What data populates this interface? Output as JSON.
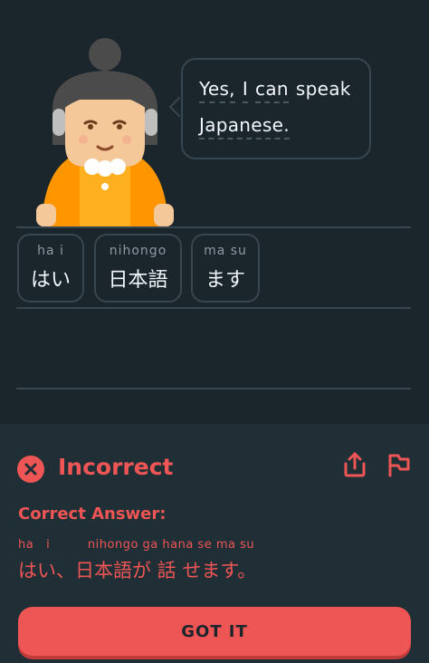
{
  "speech_bubble": {
    "line1": [
      "Yes,",
      "I",
      "can",
      "speak"
    ],
    "line2": [
      "Japanese."
    ]
  },
  "word_bank": [
    {
      "romaji": "ha  i",
      "japanese": "はい"
    },
    {
      "romaji": "nihongo",
      "japanese": "日本語"
    },
    {
      "romaji": "ma su",
      "japanese": "ます"
    }
  ],
  "feedback": {
    "status": "Incorrect",
    "correct_label": "Correct Answer:",
    "answer_romaji": "ha   i         nihongo ga hana se ma su",
    "answer_japanese": "はい、日本語が 話 せます。",
    "button_label": "GOT IT"
  },
  "colors": {
    "background": "#1b252c",
    "panel": "#202f36",
    "error": "#ee5555",
    "text": "#f1f7fb",
    "border": "#37464f"
  },
  "icons": {
    "status": "x-circle-icon",
    "share": "share-icon",
    "report": "flag-icon"
  }
}
